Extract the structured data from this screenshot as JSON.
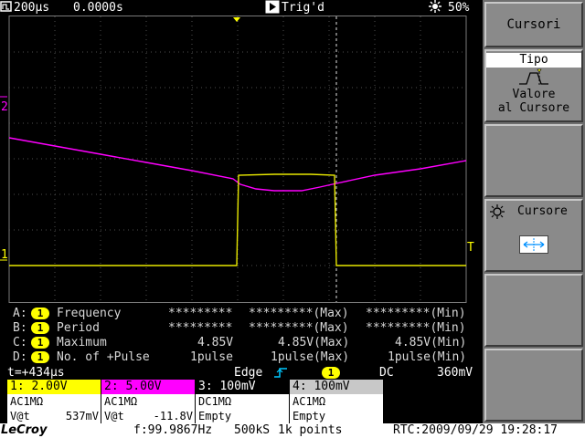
{
  "status_bar": {
    "timebase": "200µs",
    "delay": "0.0000s",
    "trigger_state": "Trig'd",
    "battery_level": "50%",
    "icons": [
      "timebase-icon",
      "play-icon",
      "battery-icon"
    ]
  },
  "display": {
    "channel2_marker": "2",
    "channel1_marker": "1",
    "trigger_level_marker": "T"
  },
  "measurements": [
    {
      "slot": "A:",
      "channel": "1",
      "name": "Frequency",
      "current": "*********",
      "max": "*********(Max)",
      "min": "*********(Min)"
    },
    {
      "slot": "B:",
      "channel": "1",
      "name": "Period",
      "current": "*********",
      "max": "*********(Max)",
      "min": "*********(Min)"
    },
    {
      "slot": "C:",
      "channel": "1",
      "name": "Maximum",
      "current": "4.85V",
      "max": "4.85V(Max)",
      "min": "4.85V(Min)"
    },
    {
      "slot": "D:",
      "channel": "1",
      "name": "No. of +Pulse",
      "current": "1pulse",
      "max": "1pulse(Max)",
      "min": "1pulse(Min)"
    }
  ],
  "trigger": {
    "cursor_time": "t=+434µs",
    "type": "Edge",
    "source": "1",
    "coupling": "DC",
    "level": "360mV"
  },
  "channels": [
    {
      "header": "1: 2.00V",
      "coupling": "AC1MΩ",
      "readout_label": "V@t",
      "readout_value": "537mV",
      "color": "#ffff00"
    },
    {
      "header": "2: 5.00V",
      "coupling": "AC1MΩ",
      "readout_label": "V@t",
      "readout_value": "-11.8V",
      "color": "#ff00ff"
    },
    {
      "header": "3: 100mV",
      "coupling": "DC1MΩ",
      "readout_label": "Empty",
      "readout_value": "",
      "color": "#c8c8c8"
    },
    {
      "header": "4: 100mV",
      "coupling": "AC1MΩ",
      "readout_label": "Empty",
      "readout_value": "",
      "color": "#c8c8c8"
    }
  ],
  "bottom_bar": {
    "brand": "LeCroy",
    "frequency": "f:99.9867Hz",
    "sample_rate": "500kS",
    "record_length": "1k points",
    "rtc": "RTC:2009/09/29 19:28:17"
  },
  "softkeys": {
    "title": "Cursori",
    "type_label": "Tipo",
    "type_value_line1": "Valore",
    "type_value_line2": "al Cursore",
    "cursor_label": "Cursore"
  },
  "colors": {
    "ch1": "#ffff00",
    "ch2": "#ff00ff",
    "grid": "#5a5a5a"
  }
}
